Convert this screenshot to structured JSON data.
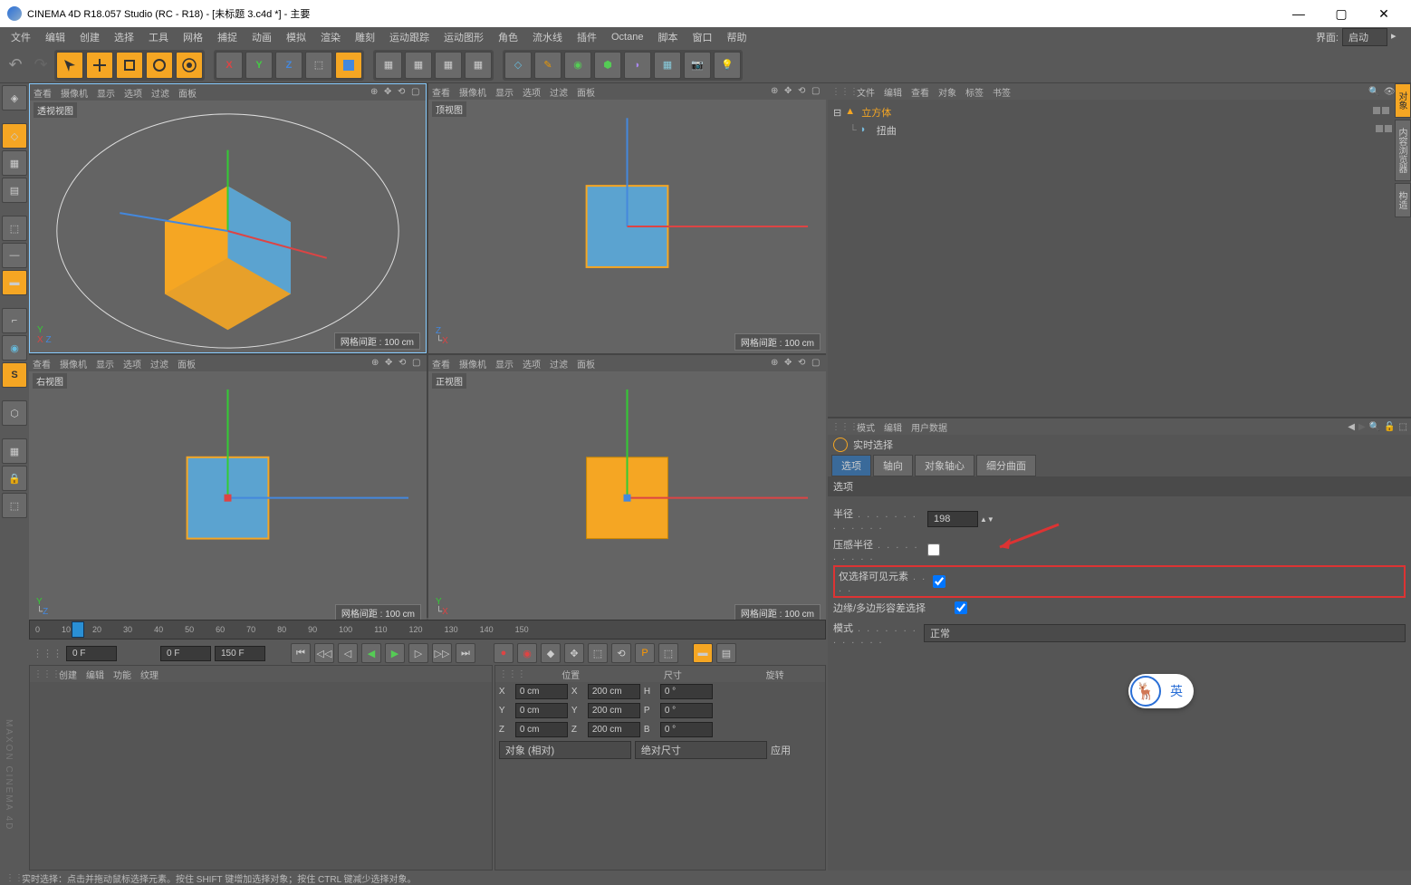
{
  "window": {
    "title": "CINEMA 4D R18.057 Studio (RC - R18) - [未标题 3.c4d *] - 主要"
  },
  "menu": {
    "items": [
      "文件",
      "编辑",
      "创建",
      "选择",
      "工具",
      "网格",
      "捕捉",
      "动画",
      "模拟",
      "渲染",
      "雕刻",
      "运动跟踪",
      "运动图形",
      "角色",
      "流水线",
      "插件",
      "Octane",
      "脚本",
      "窗口",
      "帮助"
    ],
    "right_label": "界面:",
    "layout": "启动"
  },
  "viewport_menu": [
    "查看",
    "摄像机",
    "显示",
    "选项",
    "过滤",
    "面板"
  ],
  "viewports": {
    "tl": {
      "label": "透视视图",
      "footer": "网格间距 : 100 cm"
    },
    "tr": {
      "label": "顶视图",
      "footer": "网格间距 : 100 cm"
    },
    "bl": {
      "label": "右视图",
      "footer": "网格间距 : 100 cm"
    },
    "br": {
      "label": "正视图",
      "footer": "网格间距 : 100 cm"
    }
  },
  "timeline": {
    "ticks": [
      "0",
      "10",
      "20",
      "30",
      "40",
      "50",
      "60",
      "70",
      "80",
      "90",
      "100",
      "110",
      "120",
      "130",
      "140",
      "150"
    ]
  },
  "playbar": {
    "start": "0 F",
    "end": "150 F",
    "f1": "0 F",
    "f2": "150 F"
  },
  "coords_panel_menu": [
    "创建",
    "编辑",
    "功能",
    "纹理"
  ],
  "coords": {
    "headers": [
      "位置",
      "尺寸",
      "旋转"
    ],
    "rows": [
      {
        "axis": "X",
        "pos": "0 cm",
        "size": "200 cm",
        "rlabel": "H",
        "rot": "0 °"
      },
      {
        "axis": "Y",
        "pos": "0 cm",
        "size": "200 cm",
        "rlabel": "P",
        "rot": "0 °"
      },
      {
        "axis": "Z",
        "pos": "0 cm",
        "size": "200 cm",
        "rlabel": "B",
        "rot": "0 °"
      }
    ],
    "mode": "对象 (相对)",
    "sizemode": "绝对尺寸",
    "apply": "应用"
  },
  "objects_panel_menu": [
    "文件",
    "编辑",
    "查看",
    "对象",
    "标签",
    "书签"
  ],
  "objects": {
    "root": "立方体",
    "child": "扭曲"
  },
  "attributes_panel_menu": [
    "模式",
    "编辑",
    "用户数据"
  ],
  "attributes": {
    "tool": "实时选择",
    "tabs": [
      "选项",
      "轴向",
      "对象轴心",
      "细分曲面"
    ],
    "section": "选项",
    "radius_label": "半径",
    "radius": "198",
    "pressure_label": "压感半径",
    "visible_only_label": "仅选择可见元素",
    "tolerant_label": "边缘/多边形容差选择",
    "mode_label": "模式",
    "mode_value": "正常"
  },
  "status": "实时选择：点击并拖动鼠标选择元素。按住 SHIFT 键增加选择对象；按住 CTRL 键减少选择对象。",
  "ime": {
    "lang": "英"
  }
}
